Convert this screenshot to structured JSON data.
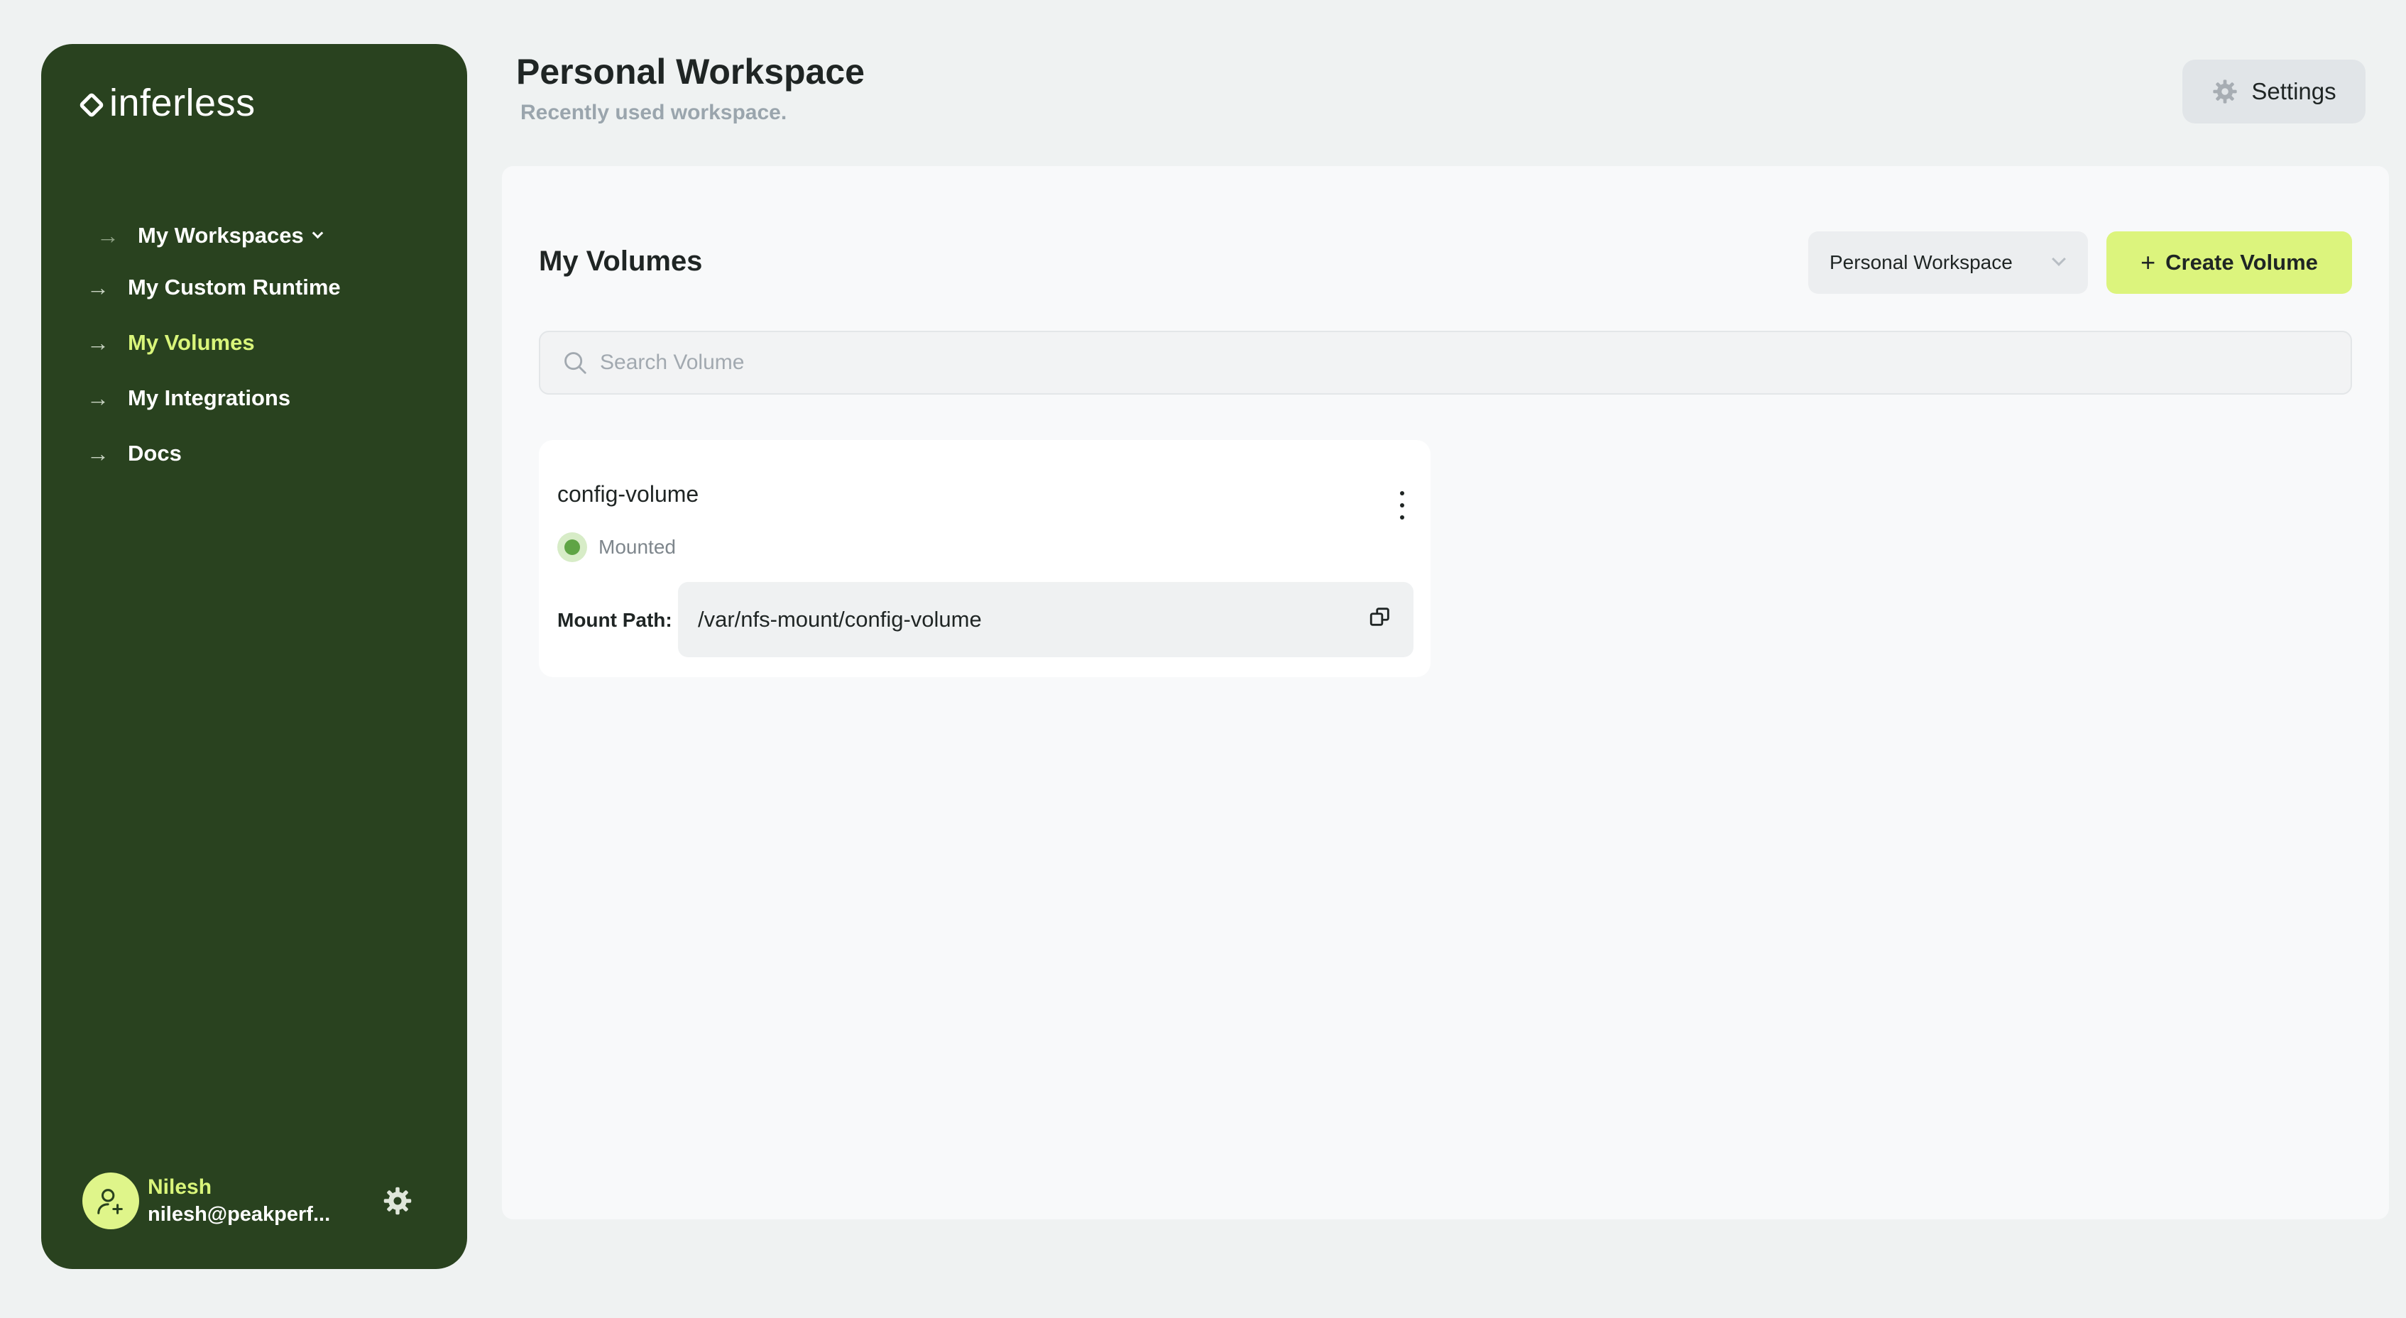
{
  "brand": {
    "name": "inferless"
  },
  "sidebar": {
    "workspaces_label": "My Workspaces",
    "items": [
      {
        "label": "My Custom Runtime",
        "active": false
      },
      {
        "label": "My Volumes",
        "active": true
      },
      {
        "label": "My Integrations",
        "active": false
      },
      {
        "label": "Docs",
        "active": false
      }
    ],
    "user": {
      "name": "Nilesh",
      "email": "nilesh@peakperf..."
    }
  },
  "header": {
    "title": "Personal Workspace",
    "subtitle": "Recently used workspace.",
    "settings_label": "Settings"
  },
  "main": {
    "section_title": "My Volumes",
    "workspace_select": {
      "value": "Personal Workspace"
    },
    "create_label": "Create Volume",
    "search": {
      "placeholder": "Search Volume",
      "value": ""
    },
    "volumes": [
      {
        "name": "config-volume",
        "status": "Mounted",
        "mount_label": "Mount Path:",
        "mount_path": "/var/nfs-mount/config-volume"
      }
    ]
  },
  "colors": {
    "sidebar_bg": "#29421f",
    "accent": "#dcf47d",
    "active_nav": "#d9f57a",
    "status_green": "#5fa445"
  }
}
